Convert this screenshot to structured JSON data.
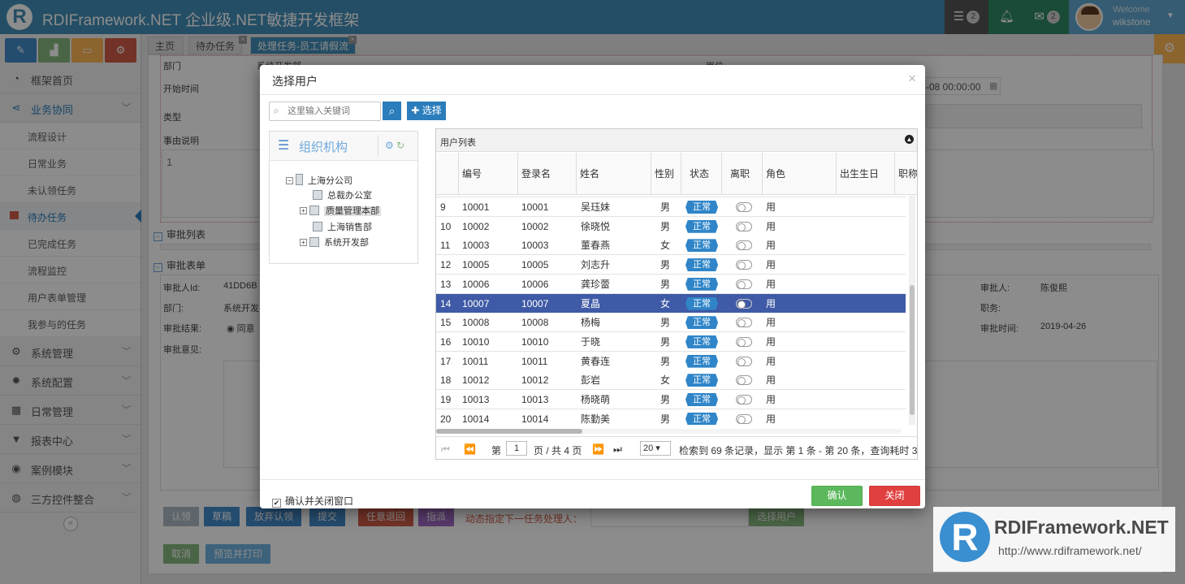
{
  "header": {
    "app_title": "RDIFramework.NET 企业级.NET敏捷开发框架",
    "logo_letter": "R",
    "tasks_count": "2",
    "messages_count": "2",
    "welcome": "Welcome",
    "username": "wikstone",
    "colors": {
      "bar": "#438eb9",
      "tasks_box": "#555555",
      "notif_box": "#2e8965",
      "msg_box": "#2e8965"
    }
  },
  "sidebar": {
    "shortcuts": [
      {
        "icon": "pencil-icon",
        "color": "#428bca"
      },
      {
        "icon": "signal-icon",
        "color": "#87b87f"
      },
      {
        "icon": "folder-icon",
        "color": "#ffb752"
      },
      {
        "icon": "cogs-icon",
        "color": "#d15b47"
      }
    ],
    "items": [
      {
        "label": "框架首页",
        "icon": "dashboard-icon"
      },
      {
        "label": "业务协同",
        "icon": "share-icon"
      },
      {
        "label": "流程设计"
      },
      {
        "label": "日常业务"
      },
      {
        "label": "未认领任务"
      },
      {
        "label": "待办任务"
      },
      {
        "label": "已完成任务"
      },
      {
        "label": "流程监控"
      },
      {
        "label": "用户表单管理"
      },
      {
        "label": "我参与的任务"
      },
      {
        "label": "系统管理",
        "icon": "cogs-icon"
      },
      {
        "label": "系统配置",
        "icon": "gear-icon"
      },
      {
        "label": "日常管理",
        "icon": "calendar-icon"
      },
      {
        "label": "报表中心",
        "icon": "filter-icon"
      },
      {
        "label": "案例模块",
        "icon": "eye-icon"
      },
      {
        "label": "三方控件整合",
        "icon": "globe-icon"
      }
    ],
    "collapse": "«"
  },
  "tabs": [
    {
      "label": "主页"
    },
    {
      "label": "待办任务"
    },
    {
      "label": "处理任务-员工请假流"
    }
  ],
  "background": {
    "row1": [
      "部门",
      "系统开发部",
      "岗位"
    ],
    "start_time_label": "开始时间",
    "end_time_value": "-08 00:00:00",
    "type_label": "类型",
    "reason_label": "事由说明",
    "textarea_value": "1",
    "approve_list_title": "审批列表",
    "approve_form_title": "审批表单",
    "approver_id_label": "审批人Id:",
    "approver_id_value": "41DD6B",
    "dept_label": "部门:",
    "dept_value": "系统开发",
    "result_label": "审批结果:",
    "result_value": "同意",
    "opinion_label": "审批意见:",
    "approver_label": "审批人:",
    "approver_value": "陈俊熙",
    "duty_label": "职务:",
    "time_label": "审批时间:",
    "time_value": "2019-04-26",
    "buttons": [
      "认领",
      "草稿",
      "放弃认领",
      "提交",
      "任意退回",
      "指派"
    ],
    "dynamic_label": "动态指定下一任务处理人：",
    "select_user_btn": "选择用户",
    "cancel_btn": "取消",
    "preview_btn": "预览并打印"
  },
  "modal": {
    "title": "选择用户",
    "close": "×",
    "search_placeholder": "这里输入关键词",
    "select_btn": "选择",
    "org_title": "组织机构",
    "tree": [
      {
        "label": "上海分公司",
        "expander": "−"
      },
      {
        "label": "总裁办公室"
      },
      {
        "label": "质量管理本部",
        "expander": "+"
      },
      {
        "label": "上海销售部"
      },
      {
        "label": "系统开发部",
        "expander": "+"
      }
    ],
    "grid_title": "用户列表",
    "columns": [
      "编号",
      "登录名",
      "姓名",
      "性别",
      "状态",
      "离职",
      "角色",
      "出生生日",
      "职称"
    ],
    "partial_row": {
      "name": "月卫",
      "role": "工作力发发开"
    },
    "rows": [
      {
        "n": "9",
        "code": "10001",
        "login": "10001",
        "name": "吴珏妹",
        "sex": "男",
        "status": "正常",
        "role": "用"
      },
      {
        "n": "10",
        "code": "10002",
        "login": "10002",
        "name": "徐晓悦",
        "sex": "男",
        "status": "正常",
        "role": "用"
      },
      {
        "n": "11",
        "code": "10003",
        "login": "10003",
        "name": "董春燕",
        "sex": "女",
        "status": "正常",
        "role": "用"
      },
      {
        "n": "12",
        "code": "10005",
        "login": "10005",
        "name": "刘志升",
        "sex": "男",
        "status": "正常",
        "role": "用"
      },
      {
        "n": "13",
        "code": "10006",
        "login": "10006",
        "name": "龚珍蕾",
        "sex": "男",
        "status": "正常",
        "role": "用"
      },
      {
        "n": "14",
        "code": "10007",
        "login": "10007",
        "name": "夏晶",
        "sex": "女",
        "status": "正常",
        "role": "用"
      },
      {
        "n": "15",
        "code": "10008",
        "login": "10008",
        "name": "杨梅",
        "sex": "男",
        "status": "正常",
        "role": "用"
      },
      {
        "n": "16",
        "code": "10010",
        "login": "10010",
        "name": "于晓",
        "sex": "男",
        "status": "正常",
        "role": "用"
      },
      {
        "n": "17",
        "code": "10011",
        "login": "10011",
        "name": "黄春连",
        "sex": "男",
        "status": "正常",
        "role": "用"
      },
      {
        "n": "18",
        "code": "10012",
        "login": "10012",
        "name": "彭岩",
        "sex": "女",
        "status": "正常",
        "role": "用"
      },
      {
        "n": "19",
        "code": "10013",
        "login": "10013",
        "name": "杨晓萌",
        "sex": "男",
        "status": "正常",
        "role": "用"
      },
      {
        "n": "20",
        "code": "10014",
        "login": "10014",
        "name": "陈勤美",
        "sex": "男",
        "status": "正常",
        "role": "用"
      }
    ],
    "selected_row": "14",
    "pager": {
      "page_prefix": "第",
      "page": "1",
      "page_suffix": "页 / 共 4 页",
      "page_size": "20",
      "summary": "检索到 69 条记录，显示 第 1 条 - 第 20 条，查询耗时 3"
    },
    "confirm_close_label": "确认并关闭窗口",
    "ok": "确认",
    "close_btn": "关闭"
  },
  "watermark": {
    "title": "RDIFramework.NET",
    "url": "http://www.rdiframework.net/",
    "letter": "R"
  }
}
